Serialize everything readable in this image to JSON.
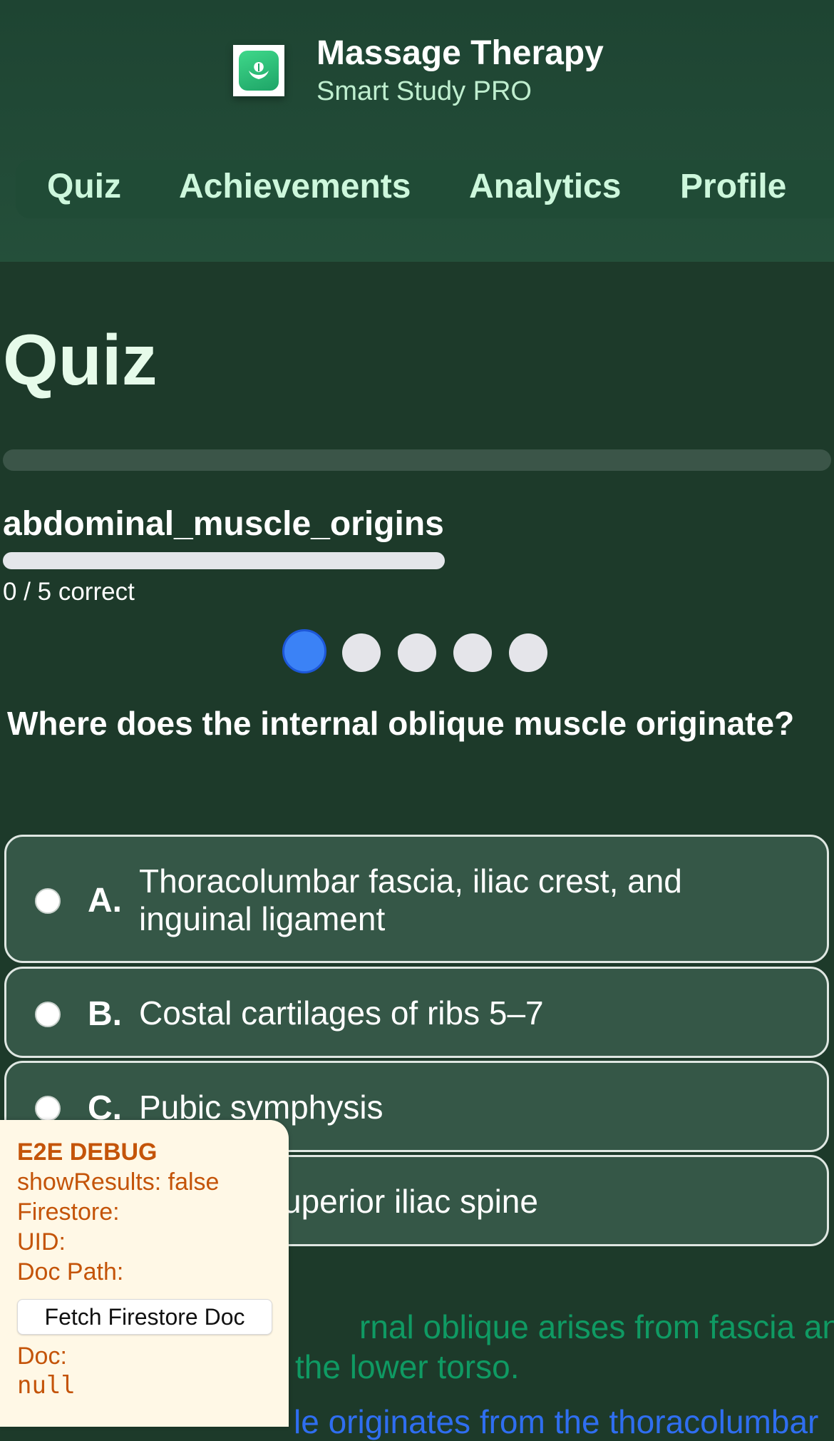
{
  "app": {
    "title": "Massage Therapy",
    "subtitle": "Smart Study PRO",
    "logo": "hands-leaf-icon",
    "accent_color": "#3b82f6"
  },
  "nav": {
    "items": [
      {
        "label": "Quiz"
      },
      {
        "label": "Achievements"
      },
      {
        "label": "Analytics"
      },
      {
        "label": "Profile"
      }
    ]
  },
  "page": {
    "title": "Quiz"
  },
  "quiz": {
    "name": "abdominal_muscle_origins",
    "progress_fraction": 0,
    "score_text": "0 / 5 correct",
    "current_question_index": 1,
    "total_questions": 5,
    "question": "Where does the internal oblique muscle originate?",
    "options": [
      {
        "letter": "A.",
        "text": "Thoracolumbar fascia, iliac crest, and inguinal ligament"
      },
      {
        "letter": "B.",
        "text": "Costal cartilages of ribs 5–7"
      },
      {
        "letter": "C.",
        "text": "Pubic symphysis"
      },
      {
        "letter": "",
        "text": "uperior iliac spine"
      }
    ],
    "explanation_visible": "rnal oblique arises from fascia and\nthe lower torso.",
    "detail_visible": "le originates from the thoracolumbar"
  },
  "debug": {
    "title": "E2E DEBUG",
    "show_results": "showResults: false",
    "firestore": "Firestore:",
    "uid": "UID:",
    "doc_path": "Doc Path:",
    "fetch_button": "Fetch Firestore Doc",
    "doc_label": "Doc:",
    "doc_value": "null"
  }
}
